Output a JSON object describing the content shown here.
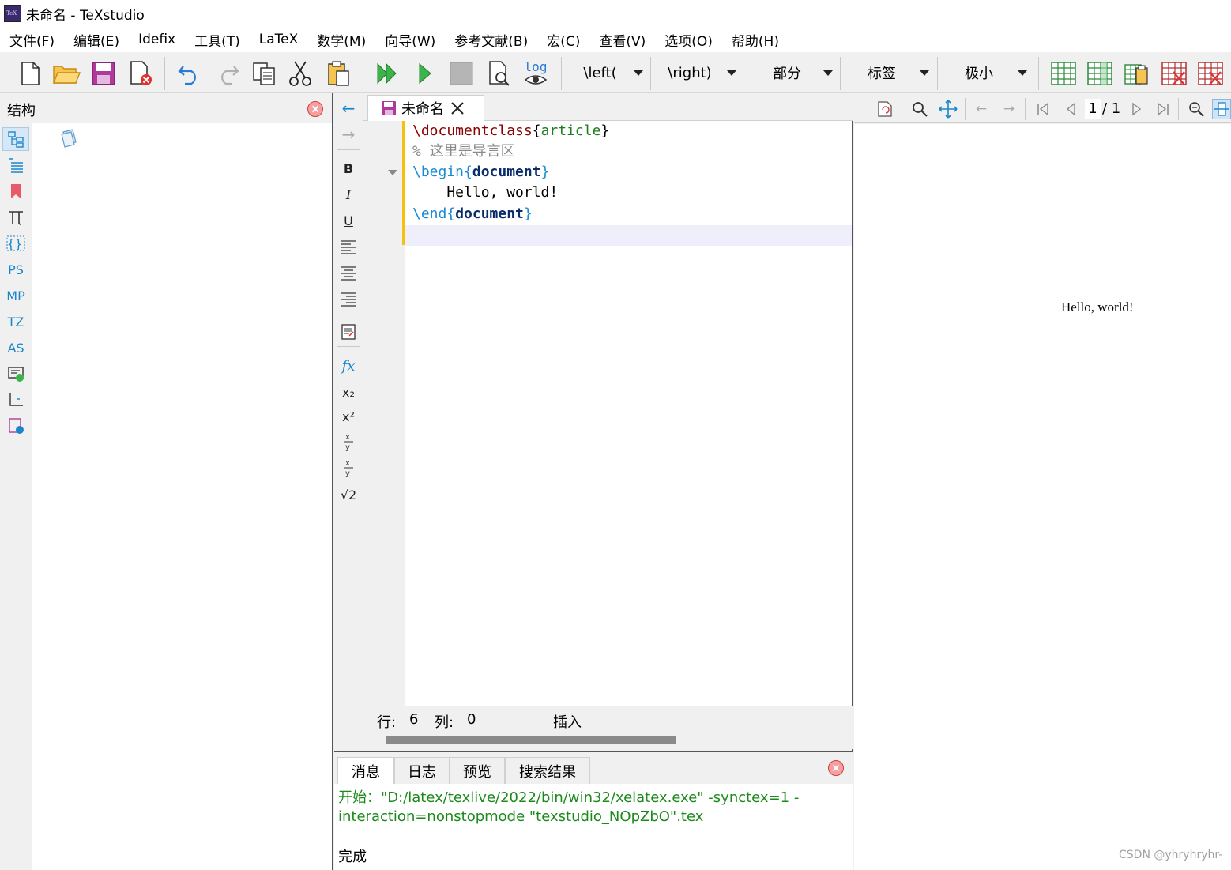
{
  "window": {
    "title": "未命名 - TeXstudio"
  },
  "menu": [
    "文件(F)",
    "编辑(E)",
    "Idefix",
    "工具(T)",
    "LaTeX",
    "数学(M)",
    "向导(W)",
    "参考文献(B)",
    "宏(C)",
    "查看(V)",
    "选项(O)",
    "帮助(H)"
  ],
  "toolbar": {
    "log_label": "log",
    "combos": [
      "\\left(",
      "\\right)",
      "部分",
      "标签",
      "极小"
    ]
  },
  "structure": {
    "title": "结构",
    "side_tabs": [
      "PS",
      "MP",
      "TZ",
      "AS"
    ]
  },
  "editor": {
    "tab_title": "未命名",
    "lines": [
      {
        "cmd": "\\documentclass",
        "lb": "{",
        "arg": "article",
        "rb": "}"
      },
      {
        "comment": "% 这里是导言区"
      },
      {
        "cmd": "\\begin",
        "lb": "{",
        "arg": "document",
        "rb": "}"
      },
      {
        "text": "    Hello, world!"
      },
      {
        "cmd": "\\end",
        "lb": "{",
        "arg": "document",
        "rb": "}"
      }
    ],
    "format_buttons": [
      "B",
      "I",
      "U"
    ],
    "math_buttons": [
      "fx",
      "x₂",
      "x²",
      "√2"
    ]
  },
  "status": {
    "row_label": "行:",
    "row": "6",
    "col_label": "列:",
    "col": "0",
    "mode": "插入"
  },
  "messages": {
    "tabs": [
      "消息",
      "日志",
      "预览",
      "搜索结果"
    ],
    "output": "开始：\"D:/latex/texlive/2022/bin/win32/xelatex.exe\" -synctex=1 -interaction=nonstopmode \"texstudio_NOpZbO\".tex",
    "done": "完成"
  },
  "pdf": {
    "page_current": "1",
    "page_total": "/ 1",
    "content": "Hello, world!"
  },
  "watermark": "CSDN @yhryhryhr-"
}
